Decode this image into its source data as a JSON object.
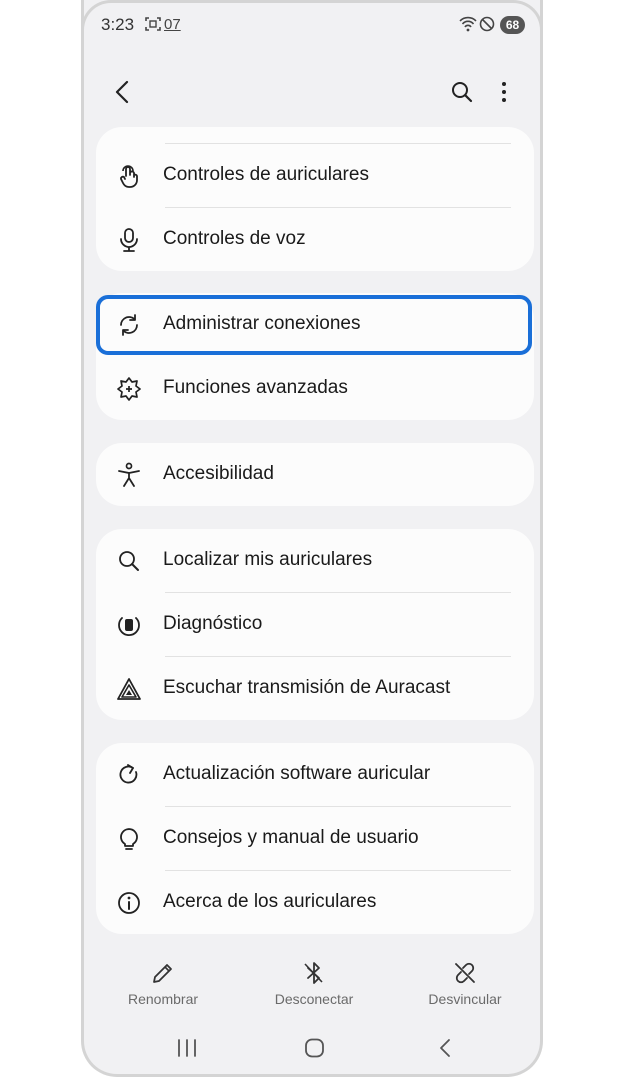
{
  "status_bar": {
    "time": "3:23",
    "notification_icons": [
      "screenshot-icon",
      "calendar-icon"
    ],
    "notification_extra": "07",
    "system_icons": [
      "wifi-icon",
      "do-not-disturb-icon"
    ],
    "battery": "68"
  },
  "app_bar": {
    "icons": [
      "back-icon",
      "search-icon",
      "more-options-icon"
    ]
  },
  "groups": [
    {
      "items": [
        {
          "icon": "touch-gesture-icon",
          "label": "Controles de auriculares"
        },
        {
          "icon": "microphone-icon",
          "label": "Controles de voz"
        }
      ]
    },
    {
      "items": [
        {
          "icon": "sync-icon",
          "label": "Administrar conexiones",
          "highlighted": true
        },
        {
          "icon": "advanced-features-icon",
          "label": "Funciones avanzadas"
        }
      ]
    },
    {
      "items": [
        {
          "icon": "accessibility-icon",
          "label": "Accesibilidad"
        }
      ]
    },
    {
      "items": [
        {
          "icon": "search-icon",
          "label": "Localizar mis auriculares"
        },
        {
          "icon": "diagnostics-icon",
          "label": "Diagnóstico"
        },
        {
          "icon": "auracast-icon",
          "label": "Escuchar transmisión de Auracast"
        }
      ]
    },
    {
      "items": [
        {
          "icon": "update-icon",
          "label": "Actualización software auricular"
        },
        {
          "icon": "lightbulb-icon",
          "label": "Consejos y manual de usuario"
        },
        {
          "icon": "info-icon",
          "label": "Acerca de los auriculares"
        }
      ]
    }
  ],
  "bottom_actions": [
    {
      "icon": "pencil-icon",
      "label": "Renombrar"
    },
    {
      "icon": "bluetooth-disconnect-icon",
      "label": "Desconectar"
    },
    {
      "icon": "unlink-icon",
      "label": "Desvincular"
    }
  ],
  "nav_bar": {
    "icons": [
      "recent-apps-icon",
      "home-icon",
      "back-nav-icon"
    ]
  },
  "colors": {
    "background": "#f1f1f3",
    "card": "#fcfcfc",
    "highlight": "#1a6fd8",
    "text": "#1a1a1a",
    "muted": "#6a6a6a"
  }
}
